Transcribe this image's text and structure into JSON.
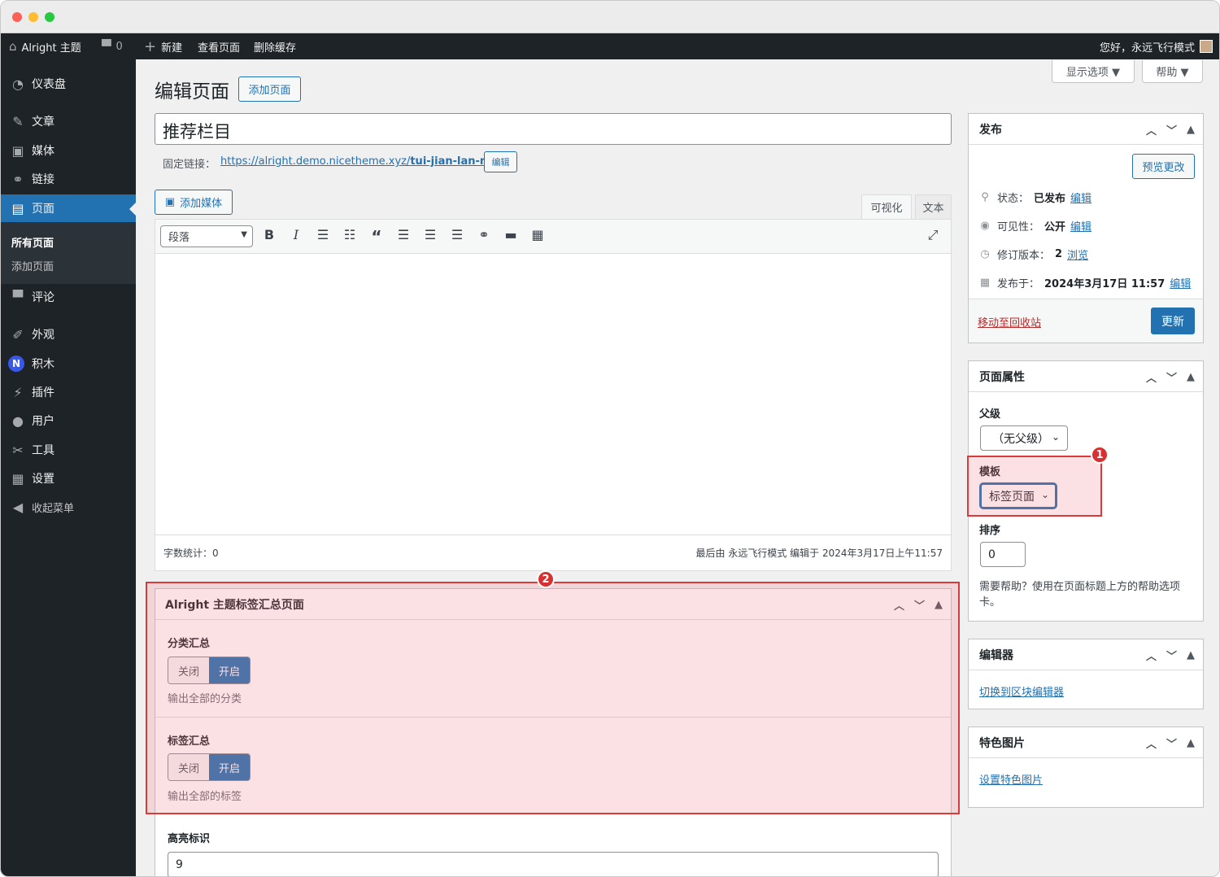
{
  "adminbar": {
    "site": "Alright 主题",
    "comments": "0",
    "new": "新建",
    "view": "查看页面",
    "cache": "删除缓存",
    "greeting": "您好，永远飞行模式"
  },
  "sidebar": {
    "items": [
      {
        "label": "仪表盘",
        "icon": "dashboard-icon"
      },
      {
        "label": "文章",
        "icon": "pin-icon"
      },
      {
        "label": "媒体",
        "icon": "media-icon"
      },
      {
        "label": "链接",
        "icon": "link-icon"
      },
      {
        "label": "页面",
        "icon": "page-icon"
      },
      {
        "label": "评论",
        "icon": "comment-icon"
      },
      {
        "label": "外观",
        "icon": "brush-icon"
      },
      {
        "label": "积木",
        "icon": "blocks-icon"
      },
      {
        "label": "插件",
        "icon": "plugin-icon"
      },
      {
        "label": "用户",
        "icon": "user-icon"
      },
      {
        "label": "工具",
        "icon": "wrench-icon"
      },
      {
        "label": "设置",
        "icon": "settings-icon"
      },
      {
        "label": "收起菜单",
        "icon": "collapse-icon"
      }
    ],
    "sub": [
      "所有页面",
      "添加页面"
    ]
  },
  "screen": {
    "options": "显示选项 ▼",
    "help": "帮助 ▼"
  },
  "header": {
    "title": "编辑页面",
    "add_new": "添加页面"
  },
  "post": {
    "title": "推荐栏目",
    "permalink_label": "固定链接：",
    "permalink_base": "https://alright.demo.nicetheme.xyz/",
    "permalink_slug": "tui-jian-lan-mu",
    "permalink_edit": "编辑"
  },
  "editor": {
    "add_media": "添加媒体",
    "tab_visual": "可视化",
    "tab_text": "文本",
    "format": "段落",
    "word_count": "字数统计：0",
    "last_edit": "最后由 永远飞行模式 编辑于 2024年3月17日上午11:57"
  },
  "publish": {
    "title": "发布",
    "preview": "预览更改",
    "status_label": "状态：",
    "status_value": "已发布",
    "visibility_label": "可见性：",
    "visibility_value": "公开",
    "revisions_label": "修订版本：",
    "revisions_value": "2",
    "revisions_link": "浏览",
    "published_label": "发布于：",
    "published_value": "2024年3月17日 11:57",
    "edit": "编辑",
    "trash": "移动至回收站",
    "update": "更新"
  },
  "attributes": {
    "title": "页面属性",
    "parent_label": "父级",
    "parent_value": "（无父级）",
    "template_label": "模板",
    "template_value": "标签页面",
    "order_label": "排序",
    "order_value": "0",
    "help": "需要帮助？使用在页面标题上方的帮助选项卡。",
    "help_line1": "需要帮助？使用在页面标题上方的帮助选项",
    "help_line2": "卡。"
  },
  "editor_box": {
    "title": "编辑器",
    "switch": "切换到区块编辑器"
  },
  "featured": {
    "title": "特色图片",
    "set": "设置特色图片"
  },
  "meta": {
    "title": "Alright 主题标签汇总页面",
    "cat_label": "分类汇总",
    "cat_off": "关闭",
    "cat_on": "开启",
    "cat_desc": "输出全部的分类",
    "tag_label": "标签汇总",
    "tag_off": "关闭",
    "tag_on": "开启",
    "tag_desc": "输出全部的标签",
    "highlight_label": "高亮标识",
    "highlight_value": "9"
  },
  "annotations": [
    "1",
    "2"
  ],
  "colors": {
    "accent": "#2271b1",
    "adminbar": "#1d2327",
    "highlight": "#d93a3a"
  }
}
